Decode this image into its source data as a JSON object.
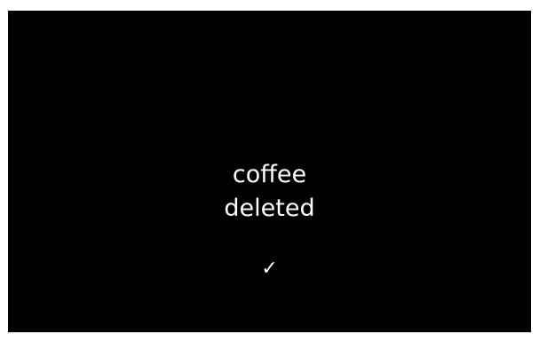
{
  "screen": {
    "background": "#000000",
    "text_color": "#ffffff",
    "message_lines": [
      "coffee",
      "deleted"
    ],
    "confirm_icon": "checkmark-icon",
    "confirm_glyph": "✓"
  }
}
